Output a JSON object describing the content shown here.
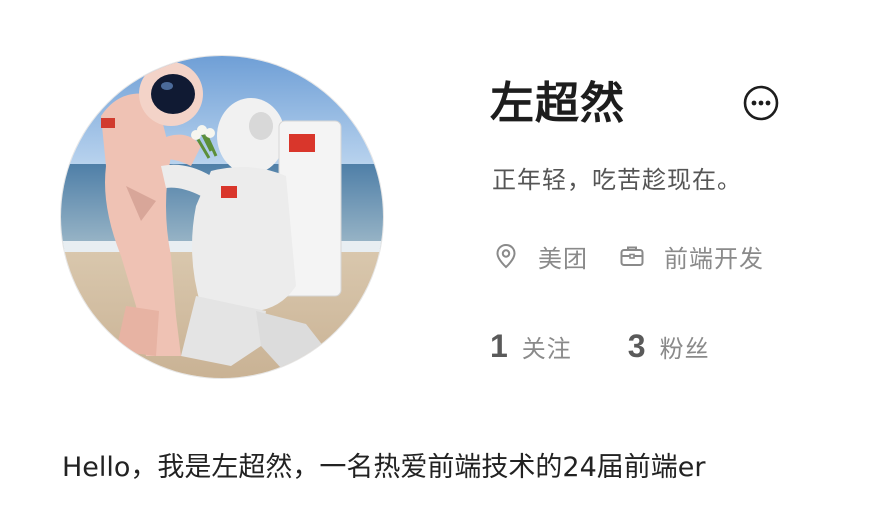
{
  "profile": {
    "name": "左超然",
    "bio": "正年轻，吃苦趁现在。",
    "company": "美团",
    "position": "前端开发",
    "intro": "Hello，我是左超然，一名热爱前端技术的24届前端er"
  },
  "stats": {
    "following_count": "1",
    "following_label": "关注",
    "followers_count": "3",
    "followers_label": "粉丝"
  },
  "icons": {
    "more": "more-options-icon",
    "location": "location-pin-icon",
    "job": "briefcase-icon"
  },
  "colors": {
    "text_primary": "#1d1d1d",
    "text_secondary": "#555555",
    "text_muted": "#8a8a8a",
    "background": "#ffffff"
  }
}
